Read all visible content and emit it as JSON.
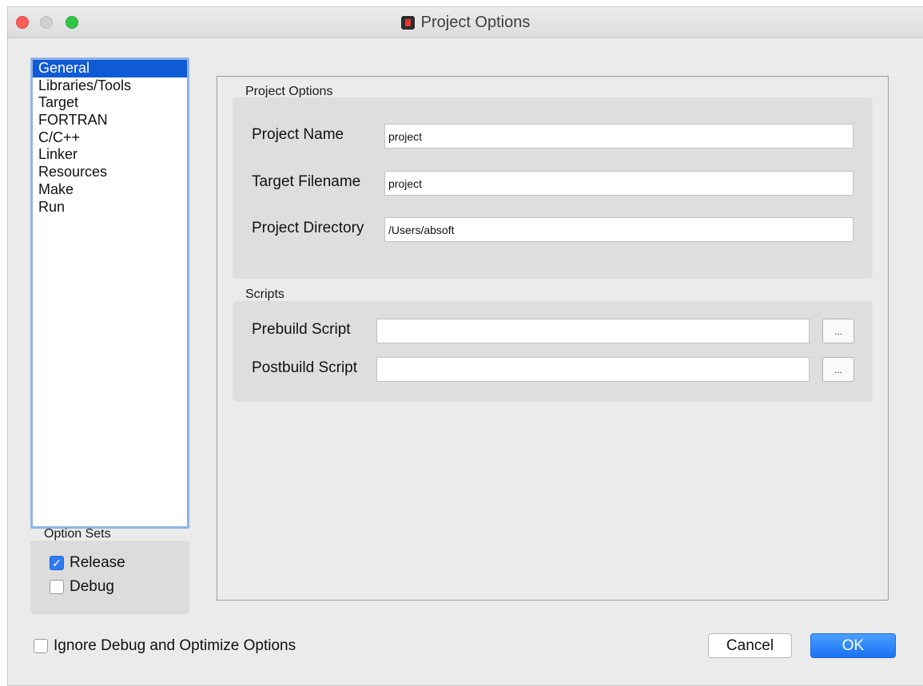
{
  "window": {
    "title": "Project Options"
  },
  "sidebar": {
    "items": [
      "General",
      "Libraries/Tools",
      "Target",
      "FORTRAN",
      "C/C++",
      "Linker",
      "Resources",
      "Make",
      "Run"
    ],
    "selected": "General"
  },
  "option_sets": {
    "label": "Option Sets",
    "release": {
      "label": "Release",
      "checked": true
    },
    "debug": {
      "label": "Debug",
      "checked": false
    }
  },
  "project_options": {
    "label": "Project Options",
    "project_name": {
      "label": "Project Name",
      "value": "project"
    },
    "target_filename": {
      "label": "Target Filename",
      "value": "project"
    },
    "project_directory": {
      "label": "Project Directory",
      "value": "/Users/absoft"
    }
  },
  "scripts": {
    "label": "Scripts",
    "prebuild": {
      "label": "Prebuild Script",
      "value": "",
      "browse_label": "..."
    },
    "postbuild": {
      "label": "Postbuild Script",
      "value": "",
      "browse_label": "..."
    }
  },
  "ignore_debug": {
    "label": "Ignore Debug and Optimize Options",
    "checked": false
  },
  "buttons": {
    "cancel": "Cancel",
    "ok": "OK"
  },
  "colors": {
    "selection": "#0f5ad5",
    "ok_button": "#1a72f4",
    "list_focus_ring": "#8fb3ea"
  }
}
